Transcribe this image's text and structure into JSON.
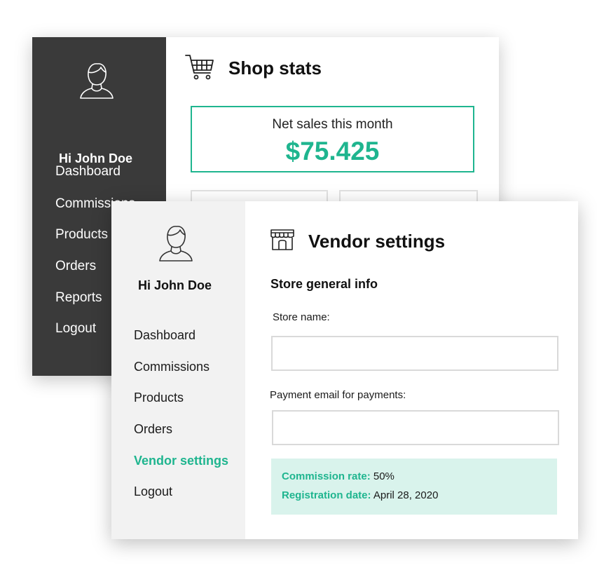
{
  "colors": {
    "accent": "#1fb58f",
    "dark_sidebar": "#3a3a3a",
    "light_sidebar": "#f2f2f2",
    "info_bg": "#d9f3ec"
  },
  "back_window": {
    "greeting": "Hi John Doe",
    "nav": [
      "Dashboard",
      "Commissions",
      "Products",
      "Orders",
      "Reports",
      "Logout"
    ],
    "title": "Shop stats",
    "title_icon": "cart-icon",
    "net_sales_label": "Net sales this month",
    "net_sales_value": "$75.425"
  },
  "front_window": {
    "greeting": "Hi John Doe",
    "nav": [
      "Dashboard",
      "Commissions",
      "Products",
      "Orders",
      "Vendor settings",
      "Logout"
    ],
    "active_nav": "Vendor settings",
    "title": "Vendor settings",
    "title_icon": "store-icon",
    "section_title": "Store general info",
    "store_name_label": "Store name:",
    "store_name_value": "",
    "payment_email_label": "Payment email for payments:",
    "payment_email_value": "",
    "commission_rate_label": "Commission rate:",
    "commission_rate_value": "50%",
    "registration_date_label": "Registration date:",
    "registration_date_value": "April 28, 2020"
  }
}
